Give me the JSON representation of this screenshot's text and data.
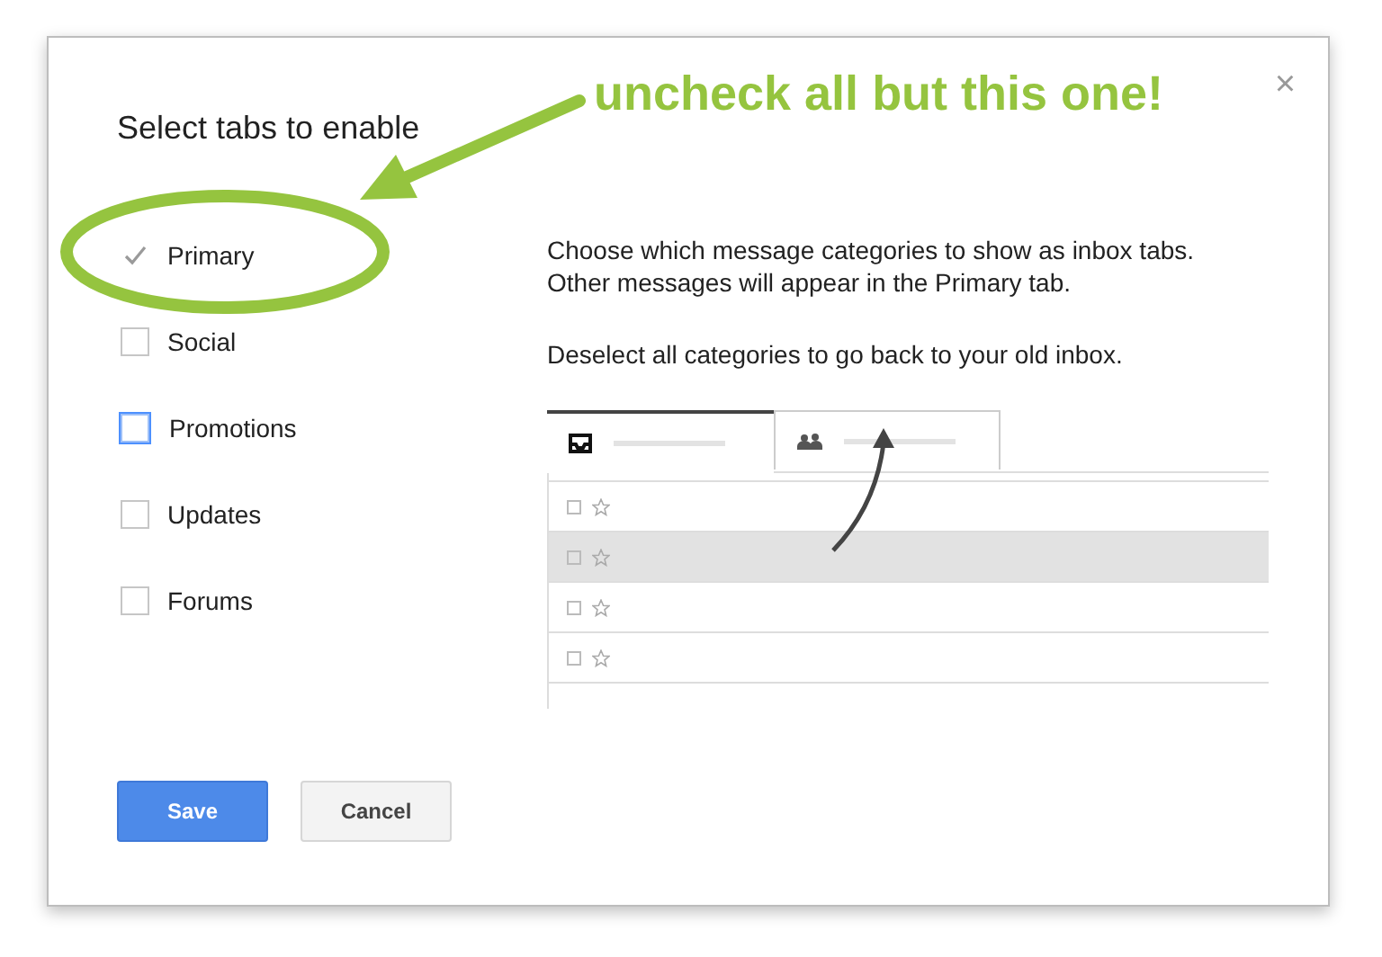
{
  "dialog": {
    "title": "Select tabs to enable",
    "close": "×"
  },
  "categories": [
    {
      "label": "Primary",
      "checked": true,
      "focused": false
    },
    {
      "label": "Social",
      "checked": false,
      "focused": false
    },
    {
      "label": "Promotions",
      "checked": false,
      "focused": true
    },
    {
      "label": "Updates",
      "checked": false,
      "focused": false
    },
    {
      "label": "Forums",
      "checked": false,
      "focused": false
    }
  ],
  "description": [
    "Choose which message categories to show as inbox tabs. Other messages will appear in the Primary tab.",
    "Deselect all categories to go back to your old inbox."
  ],
  "preview": {
    "tabs": [
      {
        "kind": "inbox",
        "selected": true
      },
      {
        "kind": "social",
        "selected": false
      }
    ],
    "rows": [
      {
        "highlighted": false
      },
      {
        "highlighted": true
      },
      {
        "highlighted": false
      },
      {
        "highlighted": false
      }
    ]
  },
  "buttons": [
    {
      "label": "Save",
      "kind": "primary"
    },
    {
      "label": "Cancel",
      "kind": "secondary"
    }
  ],
  "annotation": {
    "text": "uncheck all but this one!"
  }
}
